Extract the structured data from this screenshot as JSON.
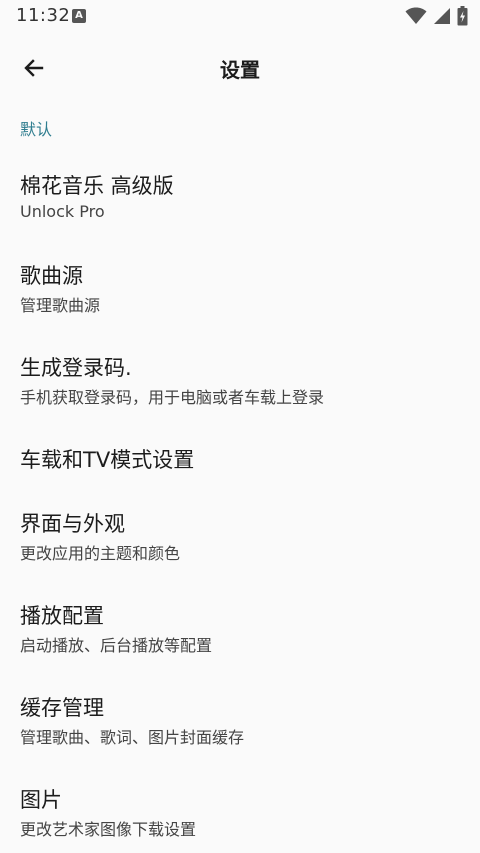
{
  "status_bar": {
    "time": "11:32",
    "notification_glyph": "A",
    "icons": [
      "wifi-icon",
      "signal-icon",
      "battery-charging-icon"
    ]
  },
  "app_bar": {
    "back_icon": "arrow-left-icon",
    "title": "设置"
  },
  "section": {
    "header": "默认"
  },
  "items": [
    {
      "title": "棉花音乐 高级版",
      "subtitle": "Unlock Pro"
    },
    {
      "title": "歌曲源",
      "subtitle": "管理歌曲源"
    },
    {
      "title": "生成登录码.",
      "subtitle": "手机获取登录码，用于电脑或者车载上登录"
    },
    {
      "title": "车载和TV模式设置",
      "subtitle": ""
    },
    {
      "title": "界面与外观",
      "subtitle": "更改应用的主题和颜色"
    },
    {
      "title": "播放配置",
      "subtitle": "启动播放、后台播放等配置"
    },
    {
      "title": "缓存管理",
      "subtitle": "管理歌曲、歌词、图片封面缓存"
    },
    {
      "title": "图片",
      "subtitle": "更改艺术家图像下载设置"
    }
  ],
  "colors": {
    "background": "#fafafa",
    "accent": "#2f7d8f",
    "text_primary": "#1c1c1c",
    "text_secondary": "#444444"
  }
}
